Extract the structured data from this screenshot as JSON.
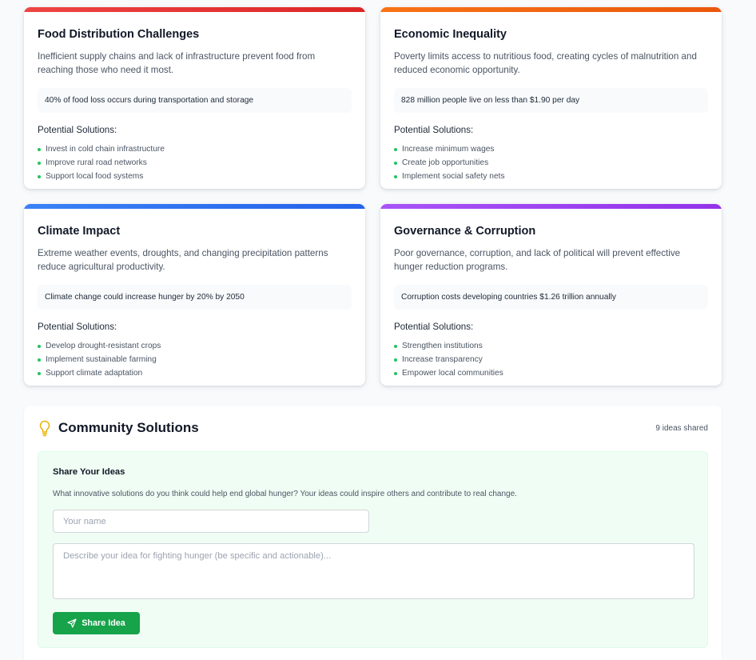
{
  "cards": [
    {
      "title": "Food Distribution Challenges",
      "description": "Inefficient supply chains and lack of infrastructure prevent food from reaching those who need it most.",
      "stat": "40% of food loss occurs during transportation and storage",
      "solutions_title": "Potential Solutions:",
      "solutions": [
        "Invest in cold chain infrastructure",
        "Improve rural road networks",
        "Support local food systems"
      ],
      "accent": "#dc2626"
    },
    {
      "title": "Economic Inequality",
      "description": "Poverty limits access to nutritious food, creating cycles of malnutrition and reduced economic opportunity.",
      "stat": "828 million people live on less than $1.90 per day",
      "solutions_title": "Potential Solutions:",
      "solutions": [
        "Increase minimum wages",
        "Create job opportunities",
        "Implement social safety nets"
      ],
      "accent": "#ea580c"
    },
    {
      "title": "Climate Impact",
      "description": "Extreme weather events, droughts, and changing precipitation patterns reduce agricultural productivity.",
      "stat": "Climate change could increase hunger by 20% by 2050",
      "solutions_title": "Potential Solutions:",
      "solutions": [
        "Develop drought-resistant crops",
        "Implement sustainable farming",
        "Support climate adaptation"
      ],
      "accent": "#2563eb"
    },
    {
      "title": "Governance & Corruption",
      "description": "Poor governance, corruption, and lack of political will prevent effective hunger reduction programs.",
      "stat": "Corruption costs developing countries $1.26 trillion annually",
      "solutions_title": "Potential Solutions:",
      "solutions": [
        "Strengthen institutions",
        "Increase transparency",
        "Empower local communities"
      ],
      "accent": "#9333ea"
    }
  ],
  "community": {
    "icon": "lightbulb-icon",
    "title": "Community Solutions",
    "count": "9 ideas shared",
    "share": {
      "title": "Share Your Ideas",
      "intro": "What innovative solutions do you think could help end global hunger? Your ideas could inspire others and contribute to real change.",
      "name_placeholder": "Your name",
      "name_value": "",
      "idea_placeholder": "Describe your idea for fighting hunger (be specific and actionable)...",
      "idea_value": "",
      "button_label": "Share Idea",
      "button_icon": "send-icon",
      "button_color": "#16a34a"
    }
  }
}
